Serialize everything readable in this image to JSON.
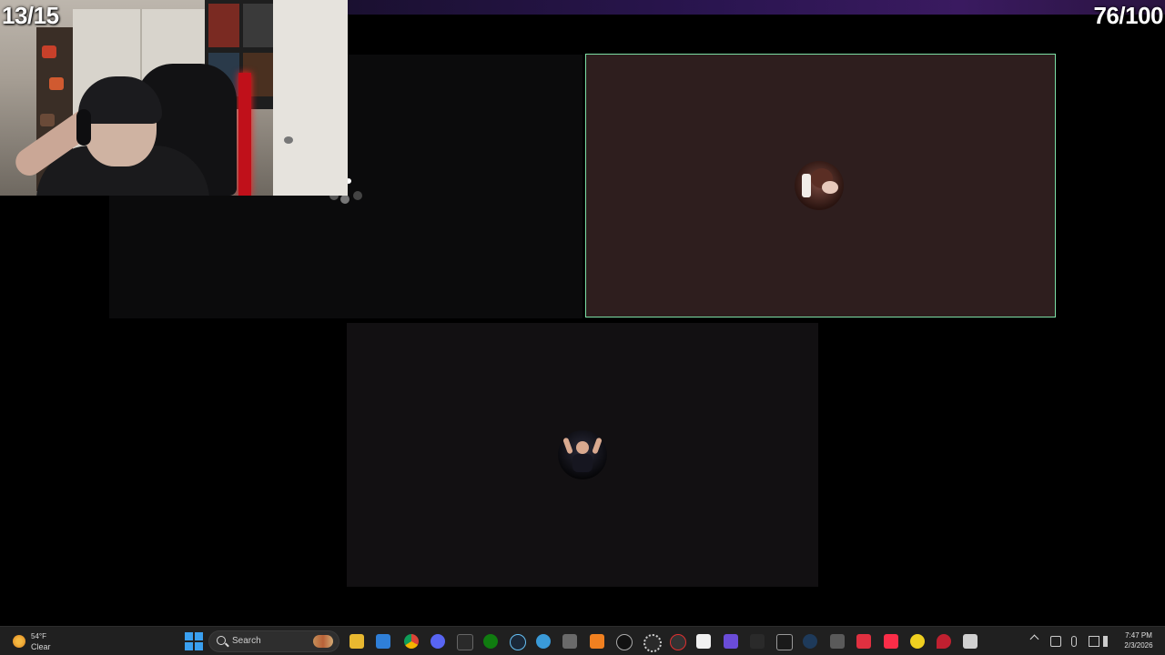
{
  "overlay": {
    "left_counter": "13/15",
    "right_counter": "76/100"
  },
  "colors": {
    "active_speaker_border": "#7de0a6",
    "active_tile_bg": "#2e1e1e",
    "taskbar_bg": "#202020"
  },
  "call": {
    "tiles": [
      {
        "id": "tile-left",
        "state": "empty"
      },
      {
        "id": "tile-active",
        "state": "speaking",
        "avatar": "participant-avatar-1"
      },
      {
        "id": "tile-bottom",
        "state": "idle",
        "avatar": "participant-avatar-2"
      }
    ]
  },
  "taskbar": {
    "weather": {
      "temp": "54°F",
      "condition": "Clear"
    },
    "search_label": "Search",
    "apps": [
      "file-explorer-icon",
      "microsoft-store-icon",
      "chrome-icon",
      "discord-icon",
      "epic-games-icon",
      "xbox-icon",
      "steam-icon",
      "app-icon",
      "minecraft-icon",
      "app-icon",
      "app-icon",
      "settings-icon",
      "app-icon",
      "notes-icon",
      "grid-app-icon",
      "ok-app-icon",
      "app-icon",
      "app-icon",
      "app-icon",
      "app-icon",
      "music-icon",
      "app-icon",
      "maps-icon",
      "app-icon"
    ],
    "clock": {
      "time": "7:47 PM",
      "date": "2/3/2026"
    }
  }
}
